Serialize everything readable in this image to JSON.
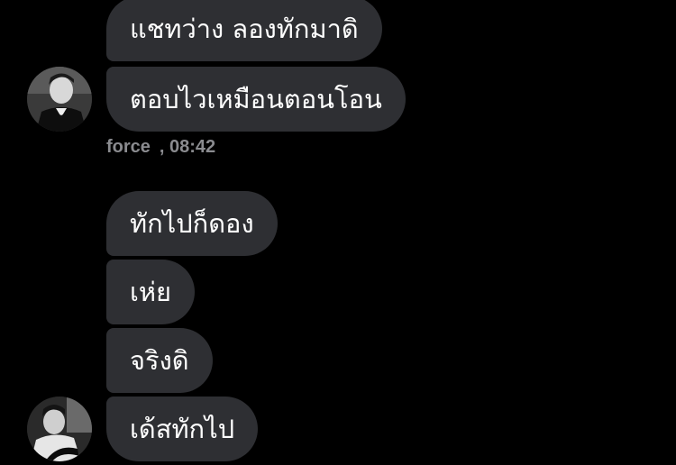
{
  "chat": {
    "group_one": {
      "messages": [
        {
          "text": "แชทว่าง ลองทักมาดิ"
        },
        {
          "text": "ตอบไวเหมือนตอนโอน"
        }
      ],
      "sender": "force",
      "time": ", 08:42"
    },
    "group_two": {
      "messages": [
        {
          "text": "ทักไปก็ดอง"
        },
        {
          "text": "เห่ย"
        },
        {
          "text": "จริงดิ"
        },
        {
          "text": "เด้สทักไป"
        }
      ]
    }
  },
  "colors": {
    "background": "#000000",
    "bubble": "#2e2f33",
    "bubble_text": "#ffffff",
    "meta_text": "#8a8b8f"
  }
}
